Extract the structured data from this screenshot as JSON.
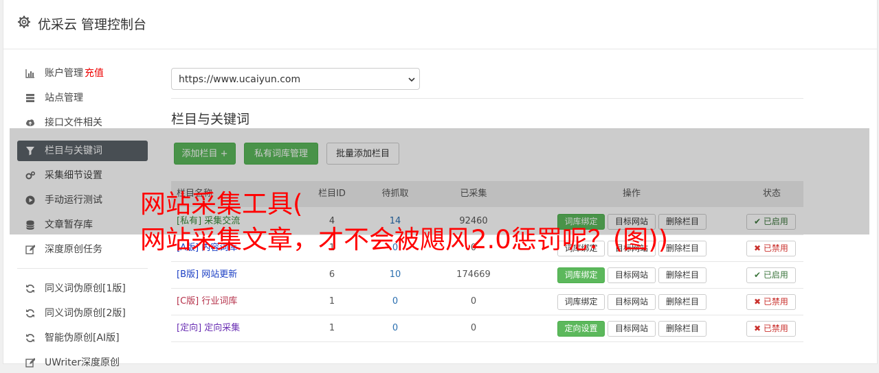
{
  "header": {
    "title": "优采云 管理控制台"
  },
  "sidebar": {
    "items": [
      {
        "label": "账户管理",
        "extra": "充值",
        "icon": "bar-chart-icon"
      },
      {
        "label": "站点管理",
        "icon": "server-icon"
      },
      {
        "label": "接口文件相关",
        "icon": "cloud-upload-icon"
      },
      {
        "label": "栏目与关键词",
        "icon": "filter-icon",
        "active": true
      },
      {
        "label": "采集细节设置",
        "icon": "cogs-icon"
      },
      {
        "label": "手动运行测试",
        "icon": "play-circle-icon"
      },
      {
        "label": "文章暂存库",
        "icon": "database-icon"
      },
      {
        "label": "深度原创任务",
        "icon": "edit-icon"
      },
      {
        "label": "同义词伪原创[1版]",
        "icon": "refresh-icon"
      },
      {
        "label": "同义词伪原创[2版]",
        "icon": "refresh-icon"
      },
      {
        "label": "智能伪原创[AI版]",
        "icon": "refresh-icon"
      },
      {
        "label": "UWriter深度原创",
        "icon": "edit-icon"
      }
    ]
  },
  "site_select": {
    "value": "https://www.ucaiyun.com"
  },
  "section": {
    "title": "栏目与关键词"
  },
  "toolbar": {
    "add_label": "添加栏目 +",
    "private_label": "私有词库管理",
    "batch_label": "批量添加栏目"
  },
  "table": {
    "headers": {
      "name": "栏目名称",
      "id": "栏目ID",
      "pending": "待抓取",
      "collected": "已采集",
      "ops": "操作",
      "status": "状态"
    },
    "rows": [
      {
        "tag": "[私有]",
        "name": "采集交流",
        "id": "4",
        "pending": "14",
        "collected": "92460",
        "op1": "词库绑定",
        "op2": "目标网站",
        "op3": "删除栏目",
        "status": "已启用",
        "name_color": "#3a8a3a",
        "op1_green": true,
        "on": true
      },
      {
        "tag": "[A版]",
        "name": "内容词库",
        "id": "1",
        "pending": "0",
        "collected": "0",
        "op1": "词库绑定",
        "op2": "目标网站",
        "op3": "删除栏目",
        "status": "已禁用",
        "name_color": "#1a3ec4",
        "op1_green": false,
        "on": false
      },
      {
        "tag": "[B版]",
        "name": "网站更新",
        "id": "6",
        "pending": "10",
        "collected": "174669",
        "op1": "词库绑定",
        "op2": "目标网站",
        "op3": "删除栏目",
        "status": "已启用",
        "name_color": "#1a3ec4",
        "op1_green": true,
        "on": true
      },
      {
        "tag": "[C版]",
        "name": "行业词库",
        "id": "1",
        "pending": "0",
        "collected": "0",
        "op1": "词库绑定",
        "op2": "目标网站",
        "op3": "删除栏目",
        "status": "已禁用",
        "name_color": "#b5314a",
        "op1_green": false,
        "on": false
      },
      {
        "tag": "[定向]",
        "name": "定向采集",
        "id": "1",
        "pending": "0",
        "collected": "0",
        "op1": "定向设置",
        "op2": "目标网站",
        "op3": "删除栏目",
        "status": "已禁用",
        "name_color": "#6a2fb3",
        "op1_green": true,
        "on": false
      }
    ]
  },
  "overlay": {
    "line1": "网站采集工具(",
    "line2": "网站采集文章，才不会被飓风2.0惩罚呢？(图))"
  },
  "colors": {
    "green": "#5cb85c",
    "active_bg": "#5a6268",
    "red_text": "#ff0000"
  }
}
